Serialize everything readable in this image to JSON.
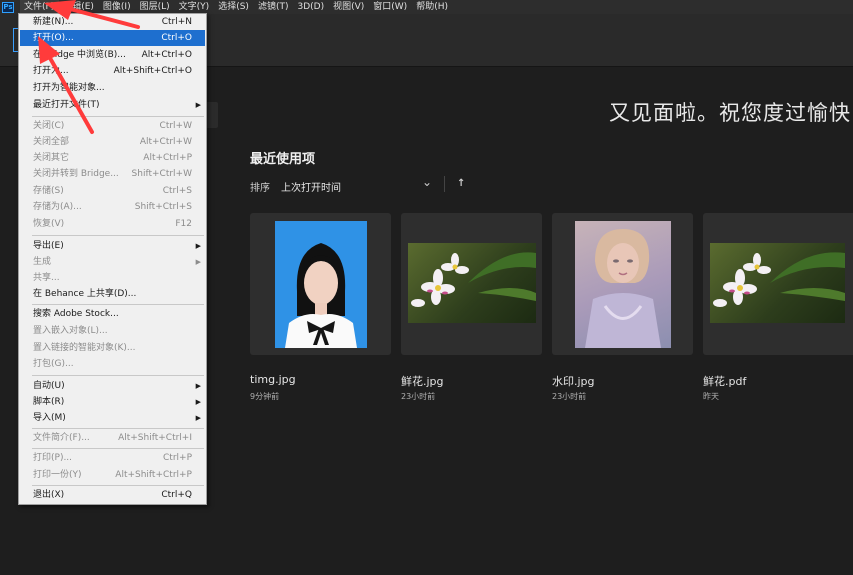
{
  "menubar": {
    "items": [
      "文件(F)",
      "编辑(E)",
      "图像(I)",
      "图层(L)",
      "文字(Y)",
      "选择(S)",
      "滤镜(T)",
      "3D(D)",
      "视图(V)",
      "窗口(W)",
      "帮助(H)"
    ],
    "logo": "Ps"
  },
  "file_menu": {
    "items": [
      {
        "label": "新建(N)...",
        "shortcut": "Ctrl+N"
      },
      {
        "label": "打开(O)...",
        "shortcut": "Ctrl+O"
      },
      {
        "label": "在 Bridge 中浏览(B)...",
        "shortcut": "Alt+Ctrl+O"
      },
      {
        "label": "打开为...",
        "shortcut": "Alt+Shift+Ctrl+O"
      },
      {
        "label": "打开为智能对象...",
        "shortcut": ""
      },
      {
        "label": "最近打开文件(T)",
        "shortcut": ""
      },
      {
        "label": "关闭(C)",
        "shortcut": "Ctrl+W"
      },
      {
        "label": "关闭全部",
        "shortcut": "Alt+Ctrl+W"
      },
      {
        "label": "关闭其它",
        "shortcut": "Alt+Ctrl+P"
      },
      {
        "label": "关闭并转到 Bridge...",
        "shortcut": "Shift+Ctrl+W"
      },
      {
        "label": "存储(S)",
        "shortcut": "Ctrl+S"
      },
      {
        "label": "存储为(A)...",
        "shortcut": "Shift+Ctrl+S"
      },
      {
        "label": "恢复(V)",
        "shortcut": "F12"
      },
      {
        "label": "导出(E)",
        "shortcut": ""
      },
      {
        "label": "生成",
        "shortcut": ""
      },
      {
        "label": "共享...",
        "shortcut": ""
      },
      {
        "label": "在 Behance 上共享(D)...",
        "shortcut": ""
      },
      {
        "label": "搜索 Adobe Stock...",
        "shortcut": ""
      },
      {
        "label": "置入嵌入对象(L)...",
        "shortcut": ""
      },
      {
        "label": "置入链接的智能对象(K)...",
        "shortcut": ""
      },
      {
        "label": "打包(G)...",
        "shortcut": ""
      },
      {
        "label": "自动(U)",
        "shortcut": ""
      },
      {
        "label": "脚本(R)",
        "shortcut": ""
      },
      {
        "label": "导入(M)",
        "shortcut": ""
      },
      {
        "label": "文件简介(F)...",
        "shortcut": "Alt+Shift+Ctrl+I"
      },
      {
        "label": "打印(P)...",
        "shortcut": "Ctrl+P"
      },
      {
        "label": "打印一份(Y)",
        "shortcut": "Alt+Shift+Ctrl+P"
      },
      {
        "label": "退出(X)",
        "shortcut": "Ctrl+Q"
      }
    ],
    "highlight_color": "#1e6fcf"
  },
  "home": {
    "welcome": "又见面啦。祝您度过愉快",
    "recent_title": "最近使用项",
    "sort_label": "排序",
    "sort_value": "上次打开时间",
    "recent_files": [
      {
        "name": "timg.jpg",
        "time": "9分钟前"
      },
      {
        "name": "鲜花.jpg",
        "time": "23小时前"
      },
      {
        "name": "水印.jpg",
        "time": "23小时前"
      },
      {
        "name": "鲜花.pdf",
        "time": "昨天"
      }
    ]
  },
  "colors": {
    "annotation_arrow": "#ff3b3b",
    "accent": "#31a8ff"
  }
}
